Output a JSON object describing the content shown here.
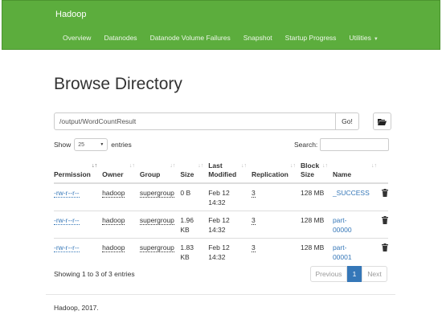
{
  "navbar": {
    "brand": "Hadoop",
    "links": [
      "Overview",
      "Datanodes",
      "Datanode Volume Failures",
      "Snapshot",
      "Startup Progress",
      "Utilities"
    ],
    "background": "#5cad3d"
  },
  "page": {
    "title": "Browse Directory",
    "path_value": "/output/WordCountResult",
    "go_label": "Go!",
    "folder_icon": "folder-open-icon"
  },
  "controls": {
    "show_label": "Show",
    "page_size": "25",
    "entries_label": "entries",
    "search_label": "Search:",
    "search_value": ""
  },
  "table": {
    "headers": {
      "permission": "Permission",
      "owner": "Owner",
      "group": "Group",
      "size": "Size",
      "last_modified_1": "Last",
      "last_modified_2": "Modified",
      "replication": "Replication",
      "block_size_1": "Block",
      "block_size_2": "Size",
      "name": "Name"
    },
    "rows": [
      {
        "permission": "-rw-r--r--",
        "owner": "hadoop",
        "group": "supergroup",
        "size_1": "0 B",
        "size_2": "",
        "modified_1": "Feb 12",
        "modified_2": "14:32",
        "replication": "3",
        "block_size": "128 MB",
        "name_1": "_SUCCESS",
        "name_2": ""
      },
      {
        "permission": "-rw-r--r--",
        "owner": "hadoop",
        "group": "supergroup",
        "size_1": "1.96",
        "size_2": "KB",
        "modified_1": "Feb 12",
        "modified_2": "14:32",
        "replication": "3",
        "block_size": "128 MB",
        "name_1": "part-",
        "name_2": "00000"
      },
      {
        "permission": "-rw-r--r--",
        "owner": "hadoop",
        "group": "supergroup",
        "size_1": "1.83",
        "size_2": "KB",
        "modified_1": "Feb 12",
        "modified_2": "14:32",
        "replication": "3",
        "block_size": "128 MB",
        "name_1": "part-",
        "name_2": "00001"
      }
    ]
  },
  "footer_table": {
    "showing": "Showing 1 to 3 of 3 entries",
    "previous": "Previous",
    "current_page": "1",
    "next": "Next"
  },
  "footer": {
    "text": "Hadoop, 2017."
  }
}
